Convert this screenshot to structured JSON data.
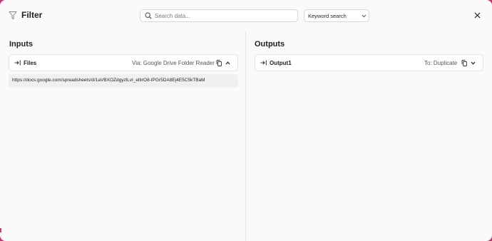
{
  "header": {
    "title": "Filter",
    "search_placeholder": "Search data...",
    "search_mode": "Keyword search",
    "icons": [
      "filter-icon",
      "search-icon",
      "chevron-down-icon",
      "close-icon"
    ]
  },
  "inputs": {
    "title": "Inputs",
    "card": {
      "name": "Files",
      "via": "Via: Google Drive Folder Reader",
      "icons": [
        "arrow-right-to-line-icon",
        "copy-icon",
        "chevron-up-icon"
      ]
    },
    "url": "https://docs.google.com/spreadsheets/d/1aVBXOZdgyzlLvI_eltirO8-IPGr5DA8Ej4E5C5kTBaM"
  },
  "outputs": {
    "title": "Outputs",
    "card": {
      "name": "Output1",
      "to": "To: Duplicate",
      "icons": [
        "arrow-right-to-line-icon",
        "copy-icon",
        "chevron-down-icon"
      ]
    }
  },
  "colors": {
    "backdrop": "#b83a6e",
    "panel": "#fafafa",
    "card": "#ffffff",
    "border": "#e3e3e3",
    "text": "#1f1f1f"
  }
}
